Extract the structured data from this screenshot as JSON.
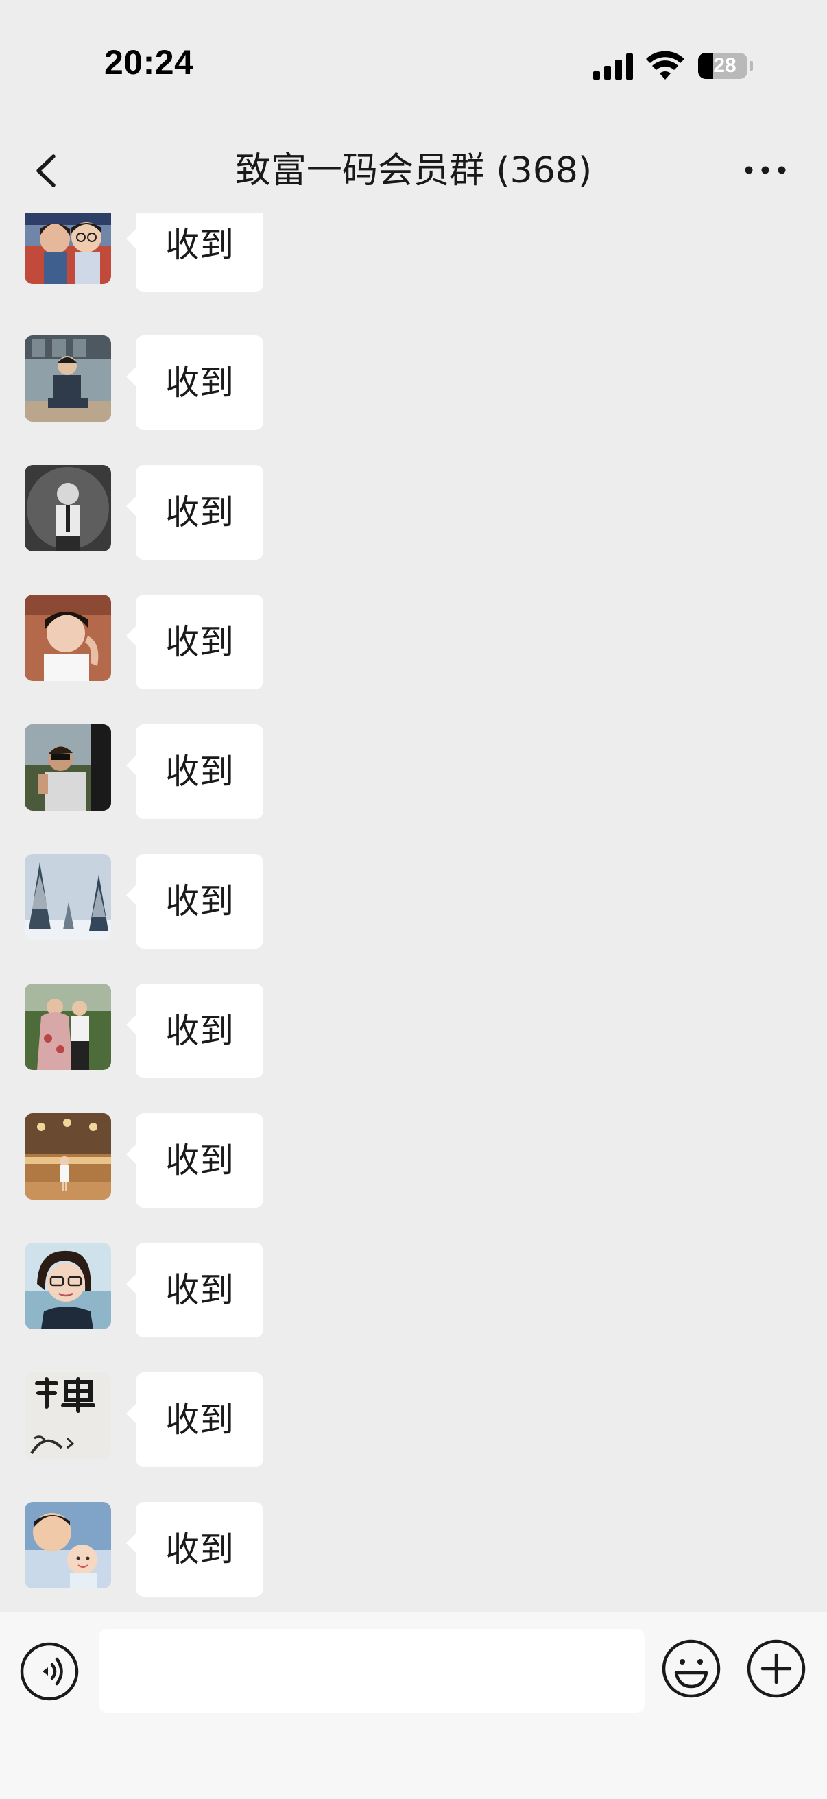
{
  "status_bar": {
    "time": "20:24",
    "battery": "28",
    "icons": [
      "signal-icon",
      "wifi-icon",
      "battery-icon"
    ]
  },
  "nav": {
    "title": "致富一码会员群 (368)",
    "back_icon": "chevron-left-icon",
    "more_icon": "more-dots-icon"
  },
  "messages": [
    {
      "text": "收到",
      "avatar": "couple-avatar"
    },
    {
      "text": "收到",
      "avatar": "man-sitting-avatar"
    },
    {
      "text": "收到",
      "avatar": "child-bw-avatar"
    },
    {
      "text": "收到",
      "avatar": "selfie-man-avatar"
    },
    {
      "text": "收到",
      "avatar": "man-sunglasses-avatar"
    },
    {
      "text": "收到",
      "avatar": "snowy-trees-avatar"
    },
    {
      "text": "收到",
      "avatar": "outdoor-couple-avatar"
    },
    {
      "text": "收到",
      "avatar": "hall-child-avatar"
    },
    {
      "text": "收到",
      "avatar": "woman-glasses-avatar"
    },
    {
      "text": "收到",
      "avatar": "zen-calligraphy-avatar"
    },
    {
      "text": "收到",
      "avatar": "father-baby-avatar"
    }
  ],
  "input_bar": {
    "placeholder": "",
    "voice_icon": "voice-icon",
    "emoji_icon": "emoji-icon",
    "plus_icon": "plus-icon"
  },
  "colors": {
    "background": "#ededed",
    "bubble": "#ffffff",
    "input_bar": "#f7f7f7"
  }
}
